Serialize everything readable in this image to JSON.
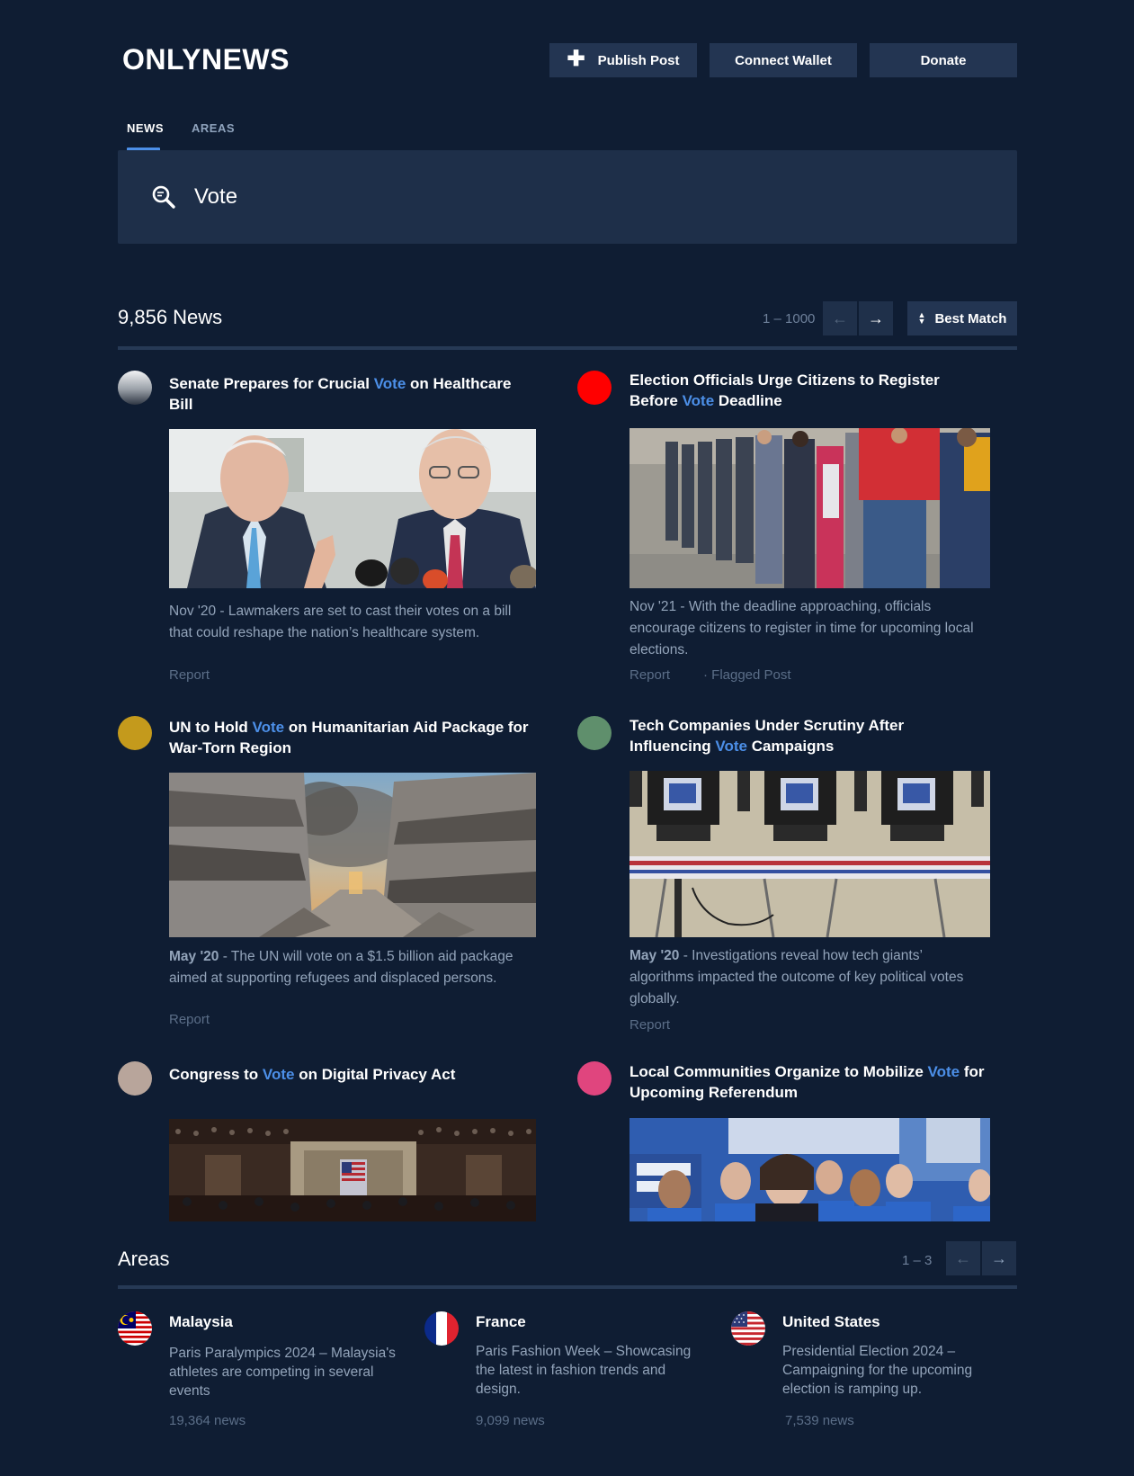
{
  "brand": {
    "name": "ONLYNEWS"
  },
  "header": {
    "publish_label": "Publish Post",
    "connect_label": "Connect Wallet",
    "donate_label": "Donate"
  },
  "tabs": [
    {
      "label": "NEWS",
      "active": true
    },
    {
      "label": "AREAS",
      "active": false
    }
  ],
  "search": {
    "value": "Vote"
  },
  "results": {
    "count_label": "9,856 News",
    "range": "1 – 1000",
    "prev_icon": "arrow-left-icon",
    "next_icon": "arrow-right-icon",
    "sort_label": "Best Match"
  },
  "news": [
    {
      "title_pre": "Senate Prepares for Crucial ",
      "title_hl": "Vote",
      "title_post": " on Healthcare Bill",
      "date": "",
      "desc": "Nov '20 - Lawmakers are set to cast their votes on a bill that could reshape the nation’s healthcare system.",
      "report": "Report",
      "avatar_color": "#c9ccd1"
    },
    {
      "title_pre": "Election Officials Urge Citizens to Register Before ",
      "title_hl": "Vote",
      "title_post": " Deadline",
      "date": "",
      "desc": "Nov '21 - With the deadline approaching, officials encourage citizens to register in time for upcoming local elections.",
      "report": "Report",
      "flag": "· Flagged Post",
      "avatar_color": "#ff0000"
    },
    {
      "title_pre": "UN to Hold ",
      "title_hl": "Vote",
      "title_post": " on Humanitarian Aid Package for War-Torn Region",
      "date": "May '20",
      "desc": " - The UN will vote on a $1.5 billion aid package aimed at supporting refugees and displaced persons.",
      "report": "Report",
      "avatar_color": "#c49a1c"
    },
    {
      "title_pre": "Tech Companies Under Scrutiny After Influencing ",
      "title_hl": "Vote",
      "title_post": " Campaigns",
      "date": "May '20",
      "desc": " - Investigations reveal how tech giants’ algorithms impacted the outcome of key political votes globally.",
      "report": "Report",
      "avatar_color": "#5f8f6c"
    },
    {
      "title_pre": "Congress to ",
      "title_hl": "Vote",
      "title_post": " on Digital Privacy Act",
      "avatar_color": "#b8a59b"
    },
    {
      "title_pre": "Local Communities Organize to Mobilize ",
      "title_hl": "Vote",
      "title_post": " for Upcoming Referendum",
      "avatar_color": "#e0457e"
    }
  ],
  "areas": {
    "title": "Areas",
    "range": "1 – 3",
    "items": [
      {
        "name": "Malaysia",
        "desc": "Paris Paralympics 2024 – Malaysia's athletes are competing in several events",
        "count": "19,364 news"
      },
      {
        "name": "France",
        "desc": "Paris Fashion Week – Showcasing the latest in fashion trends and design.",
        "count": "9,099 news"
      },
      {
        "name": "United States",
        "desc": "Presidential Election 2024 – Campaigning for the upcoming election is ramping up.",
        "count": "7,539 news"
      }
    ]
  },
  "colors": {
    "background": "#0f1d33",
    "accent": "#4c8fe8",
    "button": "#233552"
  }
}
